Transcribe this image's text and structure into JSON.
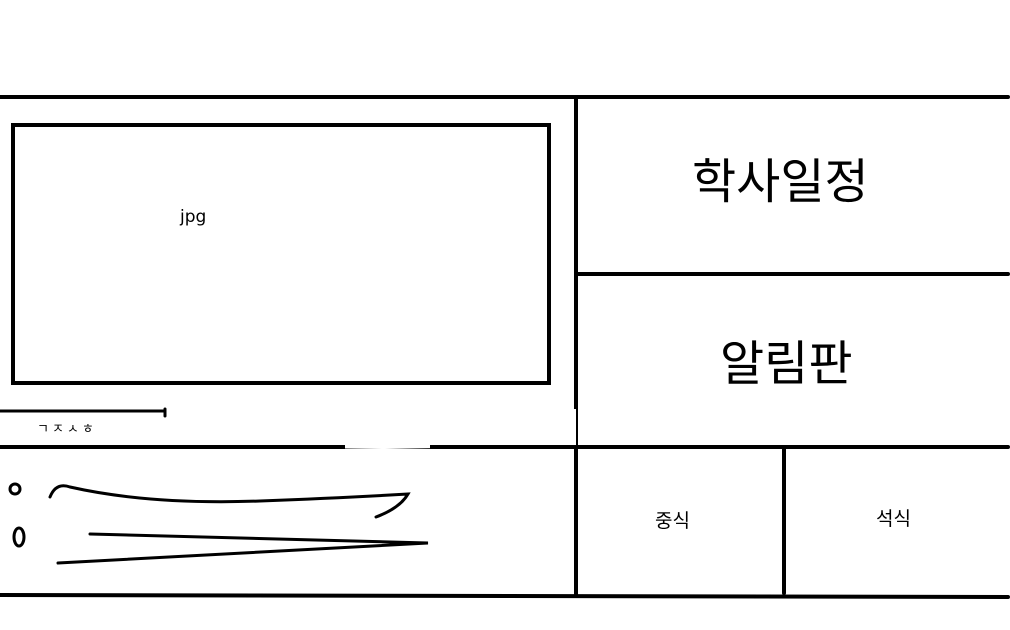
{
  "banner": {
    "image_placeholder": "jpg"
  },
  "side": {
    "schedule_label": "학사일정",
    "board_label": "알림판"
  },
  "meals": {
    "lunch_label": "중식",
    "dinner_label": "석식"
  },
  "notice": {
    "tab_label": "ㄱㅈㅅㅎ"
  },
  "colors": {
    "line": "#000000",
    "background": "#ffffff"
  }
}
